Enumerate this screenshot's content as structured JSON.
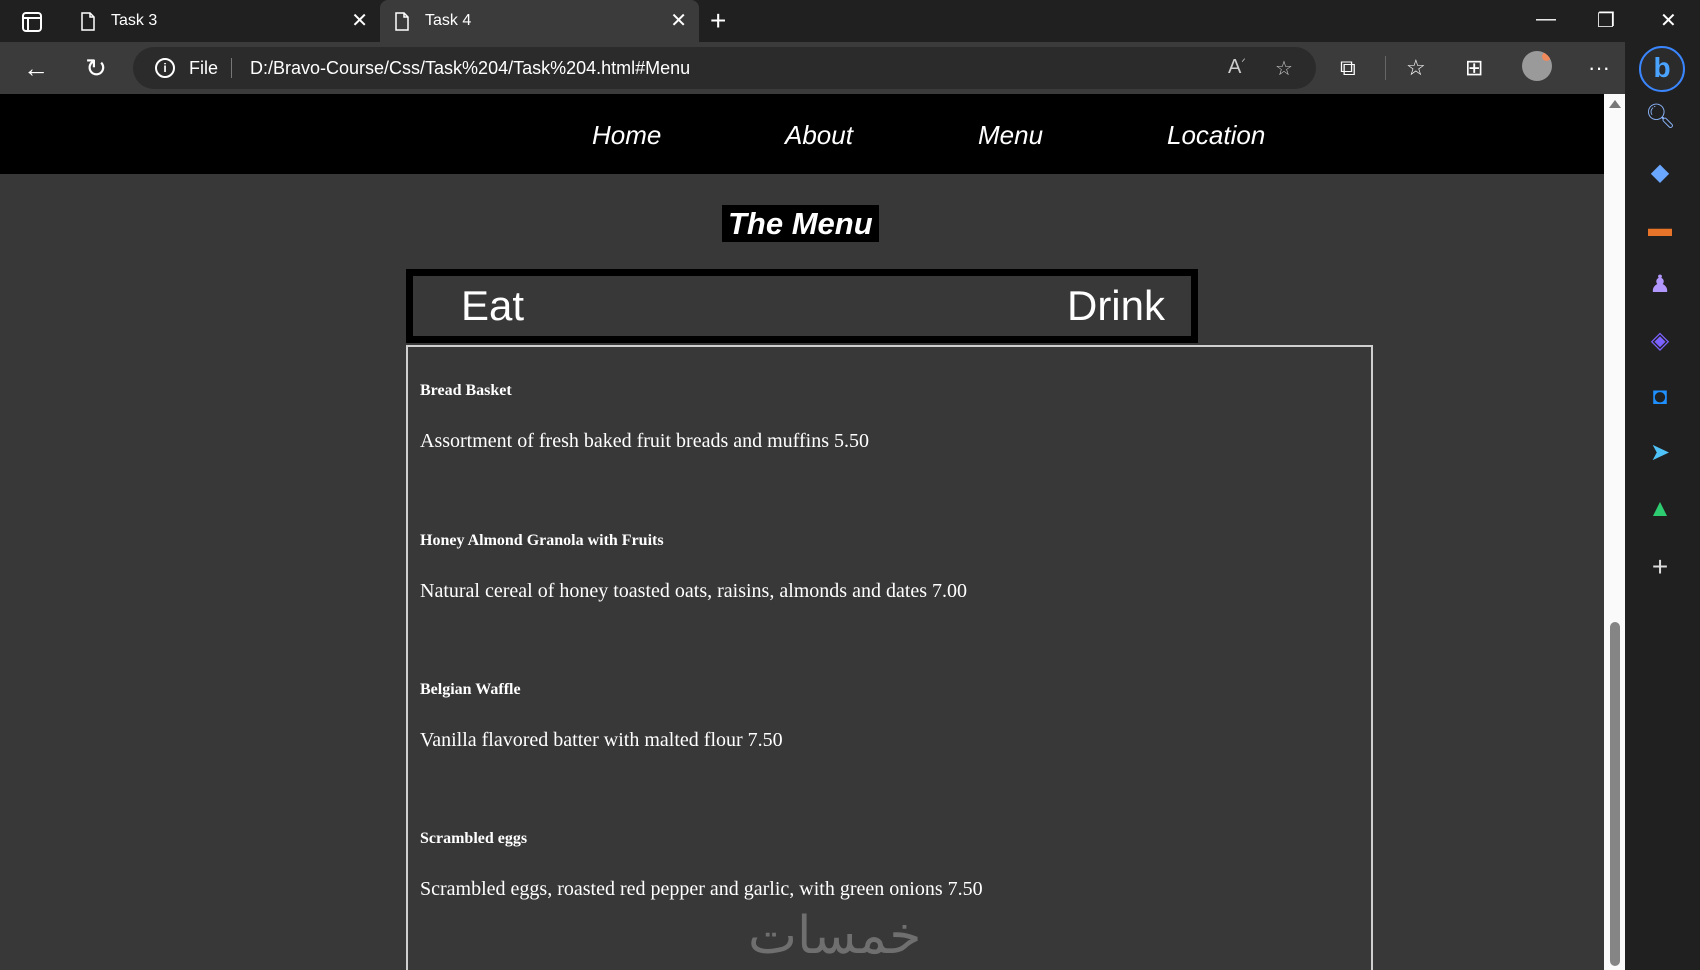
{
  "browser": {
    "tabs": [
      {
        "title": "Task 3",
        "active": false
      },
      {
        "title": "Task 4",
        "active": true
      }
    ],
    "new_tab_icon": "+",
    "window": {
      "minimize": "—",
      "restore": "❐",
      "close": "✕"
    },
    "address": {
      "scheme_label": "File",
      "url": "D:/Bravo-Course/Css/Task%204/Task%204.html#Menu"
    },
    "toolbar_icons": [
      "read-aloud-icon",
      "favorite-add-icon",
      "extensions-icon",
      "favorites-icon",
      "collections-icon",
      "profile-icon",
      "more-icon"
    ],
    "sidebar_icons": [
      "search-icon",
      "shopping-tag-icon",
      "tools-icon",
      "games-icon",
      "copilot-icon",
      "outlook-icon",
      "telegram-icon",
      "tree-icon",
      "add-icon"
    ]
  },
  "page": {
    "nav": [
      {
        "label": "Home"
      },
      {
        "label": "About"
      },
      {
        "label": "Menu"
      },
      {
        "label": "Location"
      }
    ],
    "menu_title": "The Menu",
    "menu_tabs": {
      "eat": "Eat",
      "drink": "Drink"
    },
    "items": [
      {
        "name": "Bread Basket",
        "description": "Assortment of fresh baked fruit breads and muffins 5.50"
      },
      {
        "name": "Honey Almond Granola with Fruits",
        "description": "Natural cereal of honey toasted oats, raisins, almonds and dates 7.00"
      },
      {
        "name": "Belgian Waffle",
        "description": "Vanilla flavored batter with malted flour 7.50"
      },
      {
        "name": "Scrambled eggs",
        "description": "Scrambled eggs, roasted red pepper and garlic, with green onions 7.50"
      }
    ],
    "watermark": "خمسات"
  }
}
